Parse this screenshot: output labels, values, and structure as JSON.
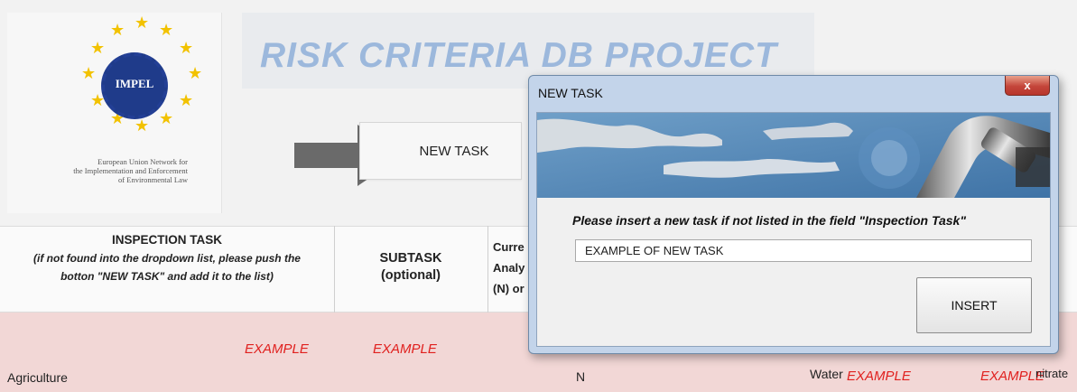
{
  "sheet": {
    "logo": {
      "text": "IMPEL",
      "caption_lines": [
        "European Union Network for",
        "the Implementation and Enforcement",
        "of Environmental Law"
      ]
    },
    "banner_title": "RISK CRITERIA DB PROJECT",
    "new_task_button": "NEW TASK"
  },
  "table": {
    "col1_header_title": "INSPECTION TASK",
    "col1_header_note_1": "(if not found into the dropdown list, please push the",
    "col1_header_note_2": "botton \"NEW TASK\" and add it to the list)",
    "col2_header_line1": "SUBTASK",
    "col2_header_line2": "(optional)",
    "col3_header_lines": [
      "Curre",
      "Analy",
      "(N) or"
    ],
    "row": {
      "task": "Agriculture",
      "task_example": "EXAMPLE",
      "subtask_example": "EXAMPLE",
      "col3_value": "N",
      "col4_value": "Water",
      "col4_example": "EXAMPLE",
      "col5_example": "EXAMPLE",
      "col5_value": "nitrate"
    }
  },
  "dialog": {
    "title": "NEW TASK",
    "close_glyph": "x",
    "prompt": "Please insert a new task if not listed in the field \"Inspection Task\"",
    "input_value": "EXAMPLE OF NEW TASK",
    "insert_button": "INSERT"
  },
  "colors": {
    "example_red": "#e0201e",
    "banner_title_blue": "#9cb8dc",
    "row_pink": "#f2d7d6",
    "dialog_frame": "#c3d4ea"
  }
}
